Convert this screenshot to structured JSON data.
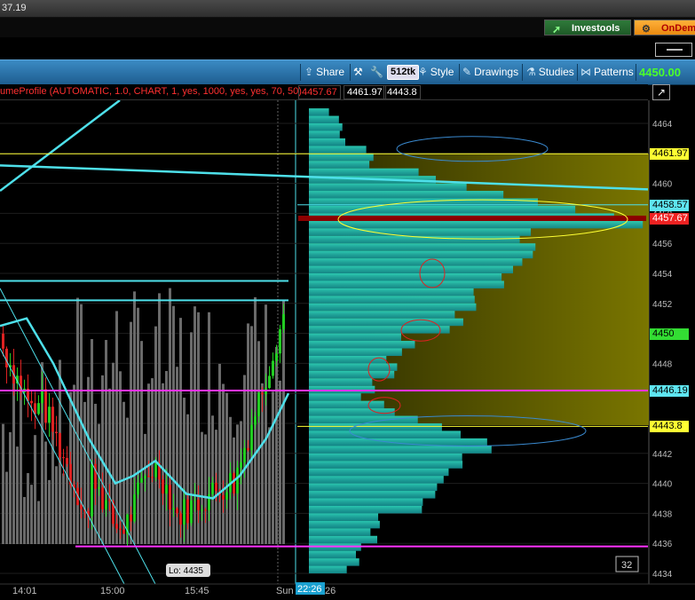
{
  "window": {
    "title_fragment": "37.19"
  },
  "topbar": {
    "investools_label": "Investools",
    "ondemand_label": "OnDem",
    "investools_icon": "arrow-icon",
    "ondemand_icon": "gear-icon"
  },
  "toolbar": {
    "share_label": "Share",
    "zoom_label": "512tk",
    "style_label": "Style",
    "drawings_label": "Drawings",
    "studies_label": "Studies",
    "patterns_label": "Patterns",
    "last_price": "4450.00"
  },
  "study": {
    "label": "umeProfile (AUTOMATIC, 1.0, CHART, 1, yes, 1000, yes, yes, 70, 50)",
    "values": [
      "4457.67",
      "4461.97",
      "4443.8"
    ]
  },
  "axis": {
    "ticks": [
      "4464",
      "4462",
      "4460",
      "4458",
      "4456",
      "4454",
      "4452",
      "4450",
      "4448",
      "4446",
      "4444",
      "4442",
      "4440",
      "4438",
      "4436",
      "4434"
    ],
    "time_labels": [
      "14:01",
      "15:00",
      "15:45",
      "Sun",
      "26"
    ],
    "cursor_time": "22:26",
    "low_label": "Lo: 4435",
    "count_box": "32"
  },
  "price_labels": [
    {
      "text": "4461.97",
      "bg": "#ffff33",
      "fg": "#000000"
    },
    {
      "text": "4458.57",
      "bg": "#5ee5f0",
      "fg": "#000000"
    },
    {
      "text": "4457.67",
      "bg": "#ee2222",
      "fg": "#ffffff"
    },
    {
      "text": "4450",
      "bg": "#33dd33",
      "fg": "#000000"
    },
    {
      "text": "4446.19",
      "bg": "#5ee5f0",
      "fg": "#000000"
    },
    {
      "text": "4443.8",
      "bg": "#ffff33",
      "fg": "#000000"
    }
  ],
  "colors": {
    "toolbar": "#2a72aa",
    "profile_fill": "#1fa8a0",
    "value_area": "#6a6a00",
    "poc": "#8b0000",
    "magenta_line": "#ff33ff",
    "cyan_line": "#4ee0ea",
    "yellow_line": "#ffff33"
  }
}
